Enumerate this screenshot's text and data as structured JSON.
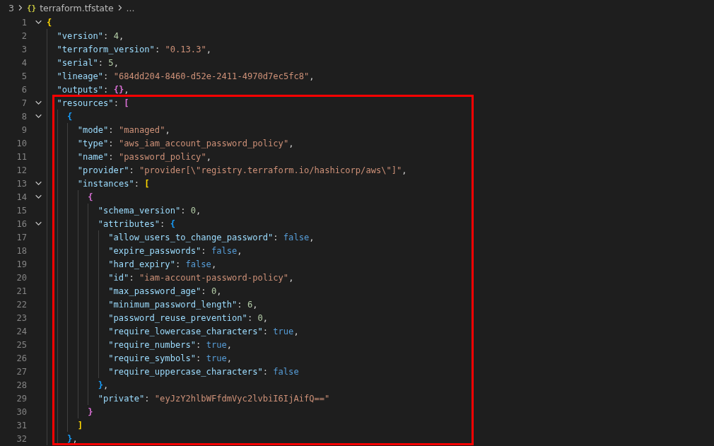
{
  "breadcrumb": [
    {
      "text": "3"
    },
    {
      "icon": "{}",
      "text": "terraform.tfstate"
    },
    {
      "text": "..."
    }
  ],
  "lines": [
    {
      "number": "1",
      "highlighted": false,
      "tokens": [
        {
          "kind": "bracket",
          "text": "{",
          "color": "#ffd700"
        }
      ],
      "children": [
        {
          "number": "2",
          "highlighted": false,
          "tokens": [
            {
              "kind": "key",
              "text": "\"version\""
            },
            {
              "kind": "punct",
              "text": ": "
            },
            {
              "kind": "number",
              "text": "4"
            },
            {
              "kind": "punct",
              "text": ","
            }
          ]
        },
        {
          "number": "3",
          "highlighted": false,
          "tokens": [
            {
              "kind": "key",
              "text": "\"terraform_version\""
            },
            {
              "kind": "punct",
              "text": ": "
            },
            {
              "kind": "string",
              "text": "\"0.13.3\""
            },
            {
              "kind": "punct",
              "text": ","
            }
          ]
        },
        {
          "number": "4",
          "highlighted": false,
          "tokens": [
            {
              "kind": "key",
              "text": "\"serial\""
            },
            {
              "kind": "punct",
              "text": ": "
            },
            {
              "kind": "number",
              "text": "5"
            },
            {
              "kind": "punct",
              "text": ","
            }
          ]
        },
        {
          "number": "5",
          "highlighted": false,
          "tokens": [
            {
              "kind": "key",
              "text": "\"lineage\""
            },
            {
              "kind": "punct",
              "text": ": "
            },
            {
              "kind": "string",
              "text": "\"684dd204-8460-d52e-2411-4970d7ec5fc8\""
            },
            {
              "kind": "punct",
              "text": ","
            }
          ]
        },
        {
          "number": "6",
          "highlighted": false,
          "tokens": [
            {
              "kind": "key",
              "text": "\"outputs\""
            },
            {
              "kind": "punct",
              "text": ": "
            },
            {
              "kind": "bracket",
              "text": "{}",
              "color": "#da70d6"
            },
            {
              "kind": "punct",
              "text": ","
            }
          ]
        },
        {
          "number": "7",
          "highlighted": true,
          "tokens": [
            {
              "kind": "key",
              "text": "\"resources\""
            },
            {
              "kind": "punct",
              "text": ": "
            },
            {
              "kind": "bracket",
              "text": "[",
              "color": "#da70d6"
            }
          ],
          "children": [
            {
              "number": "8",
              "highlighted": true,
              "tokens": [
                {
                  "kind": "bracket",
                  "text": "{",
                  "color": "#179fff"
                }
              ],
              "children": [
                {
                  "number": "9",
                  "highlighted": true,
                  "tokens": [
                    {
                      "kind": "key",
                      "text": "\"mode\""
                    },
                    {
                      "kind": "punct",
                      "text": ": "
                    },
                    {
                      "kind": "string",
                      "text": "\"managed\""
                    },
                    {
                      "kind": "punct",
                      "text": ","
                    }
                  ]
                },
                {
                  "number": "10",
                  "highlighted": true,
                  "tokens": [
                    {
                      "kind": "key",
                      "text": "\"type\""
                    },
                    {
                      "kind": "punct",
                      "text": ": "
                    },
                    {
                      "kind": "string",
                      "text": "\"aws_iam_account_password_policy\""
                    },
                    {
                      "kind": "punct",
                      "text": ","
                    }
                  ]
                },
                {
                  "number": "11",
                  "highlighted": true,
                  "tokens": [
                    {
                      "kind": "key",
                      "text": "\"name\""
                    },
                    {
                      "kind": "punct",
                      "text": ": "
                    },
                    {
                      "kind": "string",
                      "text": "\"password_policy\""
                    },
                    {
                      "kind": "punct",
                      "text": ","
                    }
                  ]
                },
                {
                  "number": "12",
                  "highlighted": true,
                  "tokens": [
                    {
                      "kind": "key",
                      "text": "\"provider\""
                    },
                    {
                      "kind": "punct",
                      "text": ": "
                    },
                    {
                      "kind": "string",
                      "text": "\"provider[\\\"registry.terraform.io/hashicorp/aws\\\"]\""
                    },
                    {
                      "kind": "punct",
                      "text": ","
                    }
                  ]
                },
                {
                  "number": "13",
                  "highlighted": true,
                  "tokens": [
                    {
                      "kind": "key",
                      "text": "\"instances\""
                    },
                    {
                      "kind": "punct",
                      "text": ": "
                    },
                    {
                      "kind": "bracket",
                      "text": "[",
                      "color": "#ffd700"
                    }
                  ],
                  "children": [
                    {
                      "number": "14",
                      "highlighted": true,
                      "tokens": [
                        {
                          "kind": "bracket",
                          "text": "{",
                          "color": "#da70d6"
                        }
                      ],
                      "children": [
                        {
                          "number": "15",
                          "highlighted": true,
                          "tokens": [
                            {
                              "kind": "key",
                              "text": "\"schema_version\""
                            },
                            {
                              "kind": "punct",
                              "text": ": "
                            },
                            {
                              "kind": "number",
                              "text": "0"
                            },
                            {
                              "kind": "punct",
                              "text": ","
                            }
                          ]
                        },
                        {
                          "number": "16",
                          "highlighted": true,
                          "tokens": [
                            {
                              "kind": "key",
                              "text": "\"attributes\""
                            },
                            {
                              "kind": "punct",
                              "text": ": "
                            },
                            {
                              "kind": "bracket",
                              "text": "{",
                              "color": "#179fff"
                            }
                          ],
                          "children": [
                            {
                              "number": "17",
                              "highlighted": true,
                              "tokens": [
                                {
                                  "kind": "key",
                                  "text": "\"allow_users_to_change_password\""
                                },
                                {
                                  "kind": "punct",
                                  "text": ": "
                                },
                                {
                                  "kind": "boolean",
                                  "text": "false"
                                },
                                {
                                  "kind": "punct",
                                  "text": ","
                                }
                              ]
                            },
                            {
                              "number": "18",
                              "highlighted": true,
                              "tokens": [
                                {
                                  "kind": "key",
                                  "text": "\"expire_passwords\""
                                },
                                {
                                  "kind": "punct",
                                  "text": ": "
                                },
                                {
                                  "kind": "boolean",
                                  "text": "false"
                                },
                                {
                                  "kind": "punct",
                                  "text": ","
                                }
                              ]
                            },
                            {
                              "number": "19",
                              "highlighted": true,
                              "tokens": [
                                {
                                  "kind": "key",
                                  "text": "\"hard_expiry\""
                                },
                                {
                                  "kind": "punct",
                                  "text": ": "
                                },
                                {
                                  "kind": "boolean",
                                  "text": "false"
                                },
                                {
                                  "kind": "punct",
                                  "text": ","
                                }
                              ]
                            },
                            {
                              "number": "20",
                              "highlighted": true,
                              "tokens": [
                                {
                                  "kind": "key",
                                  "text": "\"id\""
                                },
                                {
                                  "kind": "punct",
                                  "text": ": "
                                },
                                {
                                  "kind": "string",
                                  "text": "\"iam-account-password-policy\""
                                },
                                {
                                  "kind": "punct",
                                  "text": ","
                                }
                              ]
                            },
                            {
                              "number": "21",
                              "highlighted": true,
                              "tokens": [
                                {
                                  "kind": "key",
                                  "text": "\"max_password_age\""
                                },
                                {
                                  "kind": "punct",
                                  "text": ": "
                                },
                                {
                                  "kind": "number",
                                  "text": "0"
                                },
                                {
                                  "kind": "punct",
                                  "text": ","
                                }
                              ]
                            },
                            {
                              "number": "22",
                              "highlighted": true,
                              "tokens": [
                                {
                                  "kind": "key",
                                  "text": "\"minimum_password_length\""
                                },
                                {
                                  "kind": "punct",
                                  "text": ": "
                                },
                                {
                                  "kind": "number",
                                  "text": "6"
                                },
                                {
                                  "kind": "punct",
                                  "text": ","
                                }
                              ]
                            },
                            {
                              "number": "23",
                              "highlighted": true,
                              "tokens": [
                                {
                                  "kind": "key",
                                  "text": "\"password_reuse_prevention\""
                                },
                                {
                                  "kind": "punct",
                                  "text": ": "
                                },
                                {
                                  "kind": "number",
                                  "text": "0"
                                },
                                {
                                  "kind": "punct",
                                  "text": ","
                                }
                              ]
                            },
                            {
                              "number": "24",
                              "highlighted": true,
                              "tokens": [
                                {
                                  "kind": "key",
                                  "text": "\"require_lowercase_characters\""
                                },
                                {
                                  "kind": "punct",
                                  "text": ": "
                                },
                                {
                                  "kind": "boolean",
                                  "text": "true"
                                },
                                {
                                  "kind": "punct",
                                  "text": ","
                                }
                              ]
                            },
                            {
                              "number": "25",
                              "highlighted": true,
                              "tokens": [
                                {
                                  "kind": "key",
                                  "text": "\"require_numbers\""
                                },
                                {
                                  "kind": "punct",
                                  "text": ": "
                                },
                                {
                                  "kind": "boolean",
                                  "text": "true"
                                },
                                {
                                  "kind": "punct",
                                  "text": ","
                                }
                              ]
                            },
                            {
                              "number": "26",
                              "highlighted": true,
                              "tokens": [
                                {
                                  "kind": "key",
                                  "text": "\"require_symbols\""
                                },
                                {
                                  "kind": "punct",
                                  "text": ": "
                                },
                                {
                                  "kind": "boolean",
                                  "text": "true"
                                },
                                {
                                  "kind": "punct",
                                  "text": ","
                                }
                              ]
                            },
                            {
                              "number": "27",
                              "highlighted": true,
                              "tokens": [
                                {
                                  "kind": "key",
                                  "text": "\"require_uppercase_characters\""
                                },
                                {
                                  "kind": "punct",
                                  "text": ": "
                                },
                                {
                                  "kind": "boolean",
                                  "text": "false"
                                }
                              ]
                            }
                          ]
                        },
                        {
                          "number": "28",
                          "highlighted": true,
                          "tokens": [
                            {
                              "kind": "bracket",
                              "text": "}",
                              "color": "#179fff"
                            },
                            {
                              "kind": "punct",
                              "text": ","
                            }
                          ]
                        },
                        {
                          "number": "29",
                          "highlighted": true,
                          "tokens": [
                            {
                              "kind": "key",
                              "text": "\"private\""
                            },
                            {
                              "kind": "punct",
                              "text": ": "
                            },
                            {
                              "kind": "string",
                              "text": "\"eyJzY2hlbWFfdmVyc2lvbiI6IjAifQ==\""
                            }
                          ]
                        }
                      ]
                    },
                    {
                      "number": "30",
                      "highlighted": true,
                      "tokens": [
                        {
                          "kind": "bracket",
                          "text": "}",
                          "color": "#da70d6"
                        }
                      ]
                    }
                  ]
                },
                {
                  "number": "31",
                  "highlighted": true,
                  "tokens": [
                    {
                      "kind": "bracket",
                      "text": "]",
                      "color": "#ffd700"
                    }
                  ]
                }
              ]
            },
            {
              "number": "32",
              "highlighted": true,
              "tokens": [
                {
                  "kind": "bracket",
                  "text": "}",
                  "color": "#179fff"
                },
                {
                  "kind": "punct",
                  "text": ","
                }
              ]
            }
          ]
        }
      ]
    }
  ]
}
